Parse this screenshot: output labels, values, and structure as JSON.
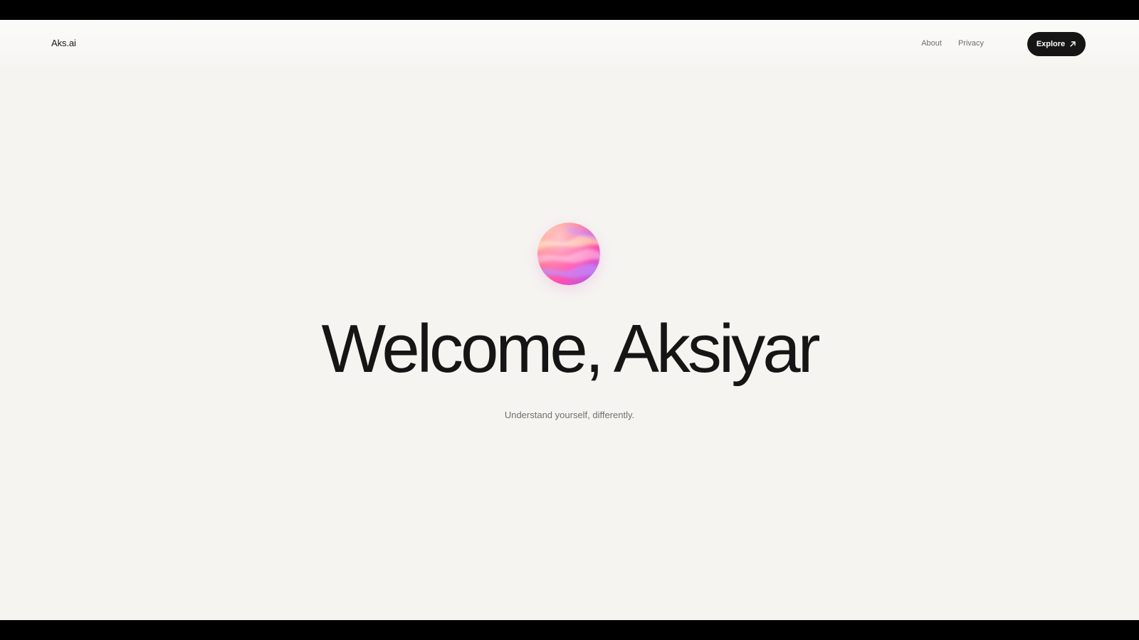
{
  "header": {
    "brand": "Aks.ai",
    "nav": [
      {
        "label": "About"
      },
      {
        "label": "Privacy"
      }
    ],
    "cta": {
      "label": "Explore",
      "icon": "arrow-up-right-icon"
    }
  },
  "hero": {
    "orb_icon": "gradient-orb",
    "title": "Welcome, Aksiyar",
    "subtitle": "Understand yourself, differently."
  },
  "colors": {
    "background": "#f5f4f1",
    "letterbox": "#000000",
    "cta_background": "#151515",
    "text_primary": "#151515",
    "text_secondary": "#707070",
    "orb_orange": "#ff8a5b",
    "orb_pink": "#ff4fa8",
    "orb_purple": "#a05cff"
  }
}
